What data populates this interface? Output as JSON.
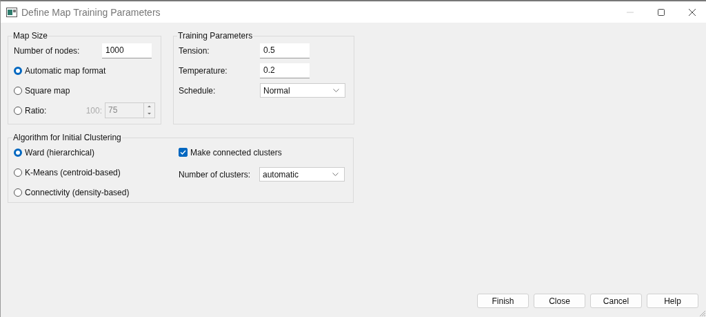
{
  "window": {
    "title": "Define Map Training Parameters"
  },
  "map_size": {
    "title": "Map Size",
    "nodes_label": "Number of nodes:",
    "nodes_value": "1000",
    "options": [
      {
        "label": "Automatic map format",
        "selected": true
      },
      {
        "label": "Square map",
        "selected": false
      },
      {
        "label": "Ratio:",
        "selected": false,
        "spinner": {
          "prefix": "100:",
          "value": "75",
          "disabled": true
        }
      }
    ]
  },
  "training": {
    "title": "Training Parameters",
    "fields": [
      {
        "kind": "text",
        "label": "Tension:",
        "value": "0.5"
      },
      {
        "kind": "text",
        "label": "Temperature:",
        "value": "0.2"
      },
      {
        "kind": "dropdown",
        "label": "Schedule:",
        "value": "Normal"
      }
    ]
  },
  "algorithm": {
    "title": "Algorithm for Initial Clustering",
    "options": [
      {
        "label": "Ward (hierarchical)",
        "selected": true
      },
      {
        "label": "K-Means (centroid-based)",
        "selected": false
      },
      {
        "label": "Connectivity (density-based)",
        "selected": false
      }
    ],
    "connected": {
      "label": "Make connected clusters",
      "checked": true
    },
    "clusters": {
      "label": "Number of clusters:",
      "value": "automatic"
    }
  },
  "buttons": [
    "Finish",
    "Close",
    "Cancel",
    "Help"
  ]
}
